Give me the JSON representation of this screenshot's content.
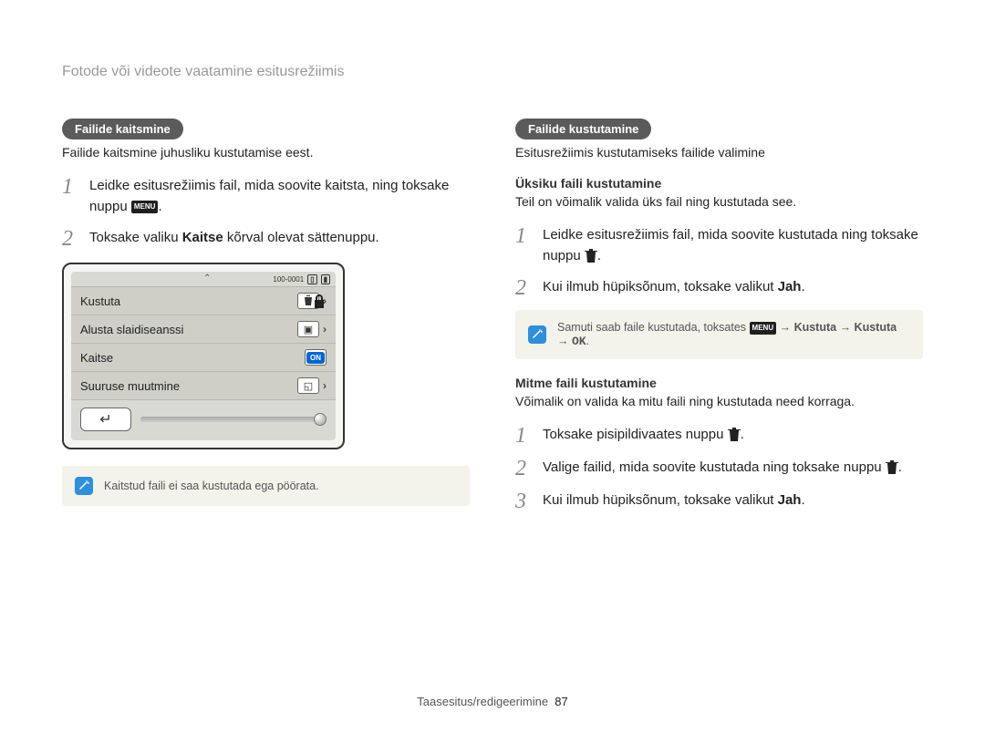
{
  "page_header": "Fotode või videote vaatamine esitusrežiimis",
  "left": {
    "pill": "Failide kaitsmine",
    "subtext": "Failide kaitsmine juhusliku kustutamise eest.",
    "steps": {
      "s1_a": "Leidke esitusrežiimis fail, mida soovite kaitsta, ning toksake nuppu ",
      "s1_icon": "MENU",
      "s1_b": ".",
      "s2_a": "Toksake valiku ",
      "s2_bold": "Kaitse",
      "s2_b": " kõrval olevat sättenuppu."
    },
    "device": {
      "top_count": "100-0001",
      "items": {
        "r1": "Kustuta",
        "r2": "Alusta slaidiseanssi",
        "r3": "Kaitse",
        "r3_on": "ON",
        "r4": "Suuruse muutmine"
      }
    },
    "note": "Kaitstud faili ei saa kustutada ega pöörata."
  },
  "right": {
    "pill": "Failide kustutamine",
    "subtext": "Esitusrežiimis kustutamiseks failide valimine",
    "single": {
      "heading": "Üksiku faili kustutamine",
      "desc": "Teil on võimalik valida üks fail ning kustutada see.",
      "s1_a": "Leidke esitusrežiimis fail, mida soovite kustutada ning toksake nuppu ",
      "s1_b": ".",
      "s2_a": "Kui ilmub hüpiksõnum, toksake valikut ",
      "s2_bold": "Jah",
      "s2_b": "."
    },
    "note_a": "Samuti saab faile kustutada, toksates ",
    "note_icon": "MENU",
    "note_b": " → ",
    "note_bold1": "Kustuta",
    "note_c": " → ",
    "note_bold2": "Kustuta",
    "note_d": " → ",
    "note_ok": "OK",
    "note_e": ".",
    "multi": {
      "heading": "Mitme faili kustutamine",
      "desc": "Võimalik on valida ka mitu faili ning kustutada need korraga.",
      "s1_a": "Toksake pisipildivaates nuppu ",
      "s1_b": ".",
      "s2_a": "Valige failid, mida soovite kustutada ning toksake nuppu ",
      "s2_b": ".",
      "s3_a": "Kui ilmub hüpiksõnum, toksake valikut ",
      "s3_bold": "Jah",
      "s3_b": "."
    }
  },
  "footer": {
    "section": "Taasesitus/redigeerimine",
    "page": "87"
  }
}
